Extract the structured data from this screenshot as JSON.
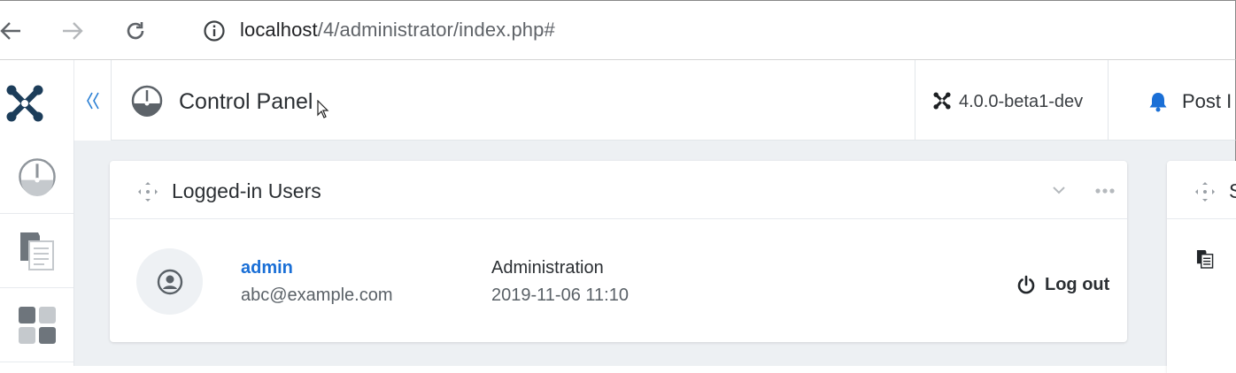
{
  "browser": {
    "url_host": "localhost",
    "url_path": "/4/administrator/index.php#"
  },
  "header": {
    "page_title": "Control Panel",
    "version": "4.0.0-beta1-dev",
    "post_install_label": "Post I"
  },
  "sidebar": {
    "items": [
      {
        "name": "dashboard",
        "icon": "speedometer-icon"
      },
      {
        "name": "content",
        "icon": "copy-icon"
      },
      {
        "name": "components",
        "icon": "blocks-icon"
      }
    ]
  },
  "modules": {
    "logged_in_users": {
      "title": "Logged-in Users",
      "users": [
        {
          "name": "admin",
          "email": "abc@example.com",
          "client": "Administration",
          "datetime": "2019-11-06 11:10",
          "logout_label": "Log out"
        }
      ]
    },
    "second_module": {
      "title_visible": "S"
    }
  },
  "colors": {
    "accent": "#1a6fd6",
    "background": "#edf0f3",
    "joomla_logo": "#1c3d5a"
  }
}
